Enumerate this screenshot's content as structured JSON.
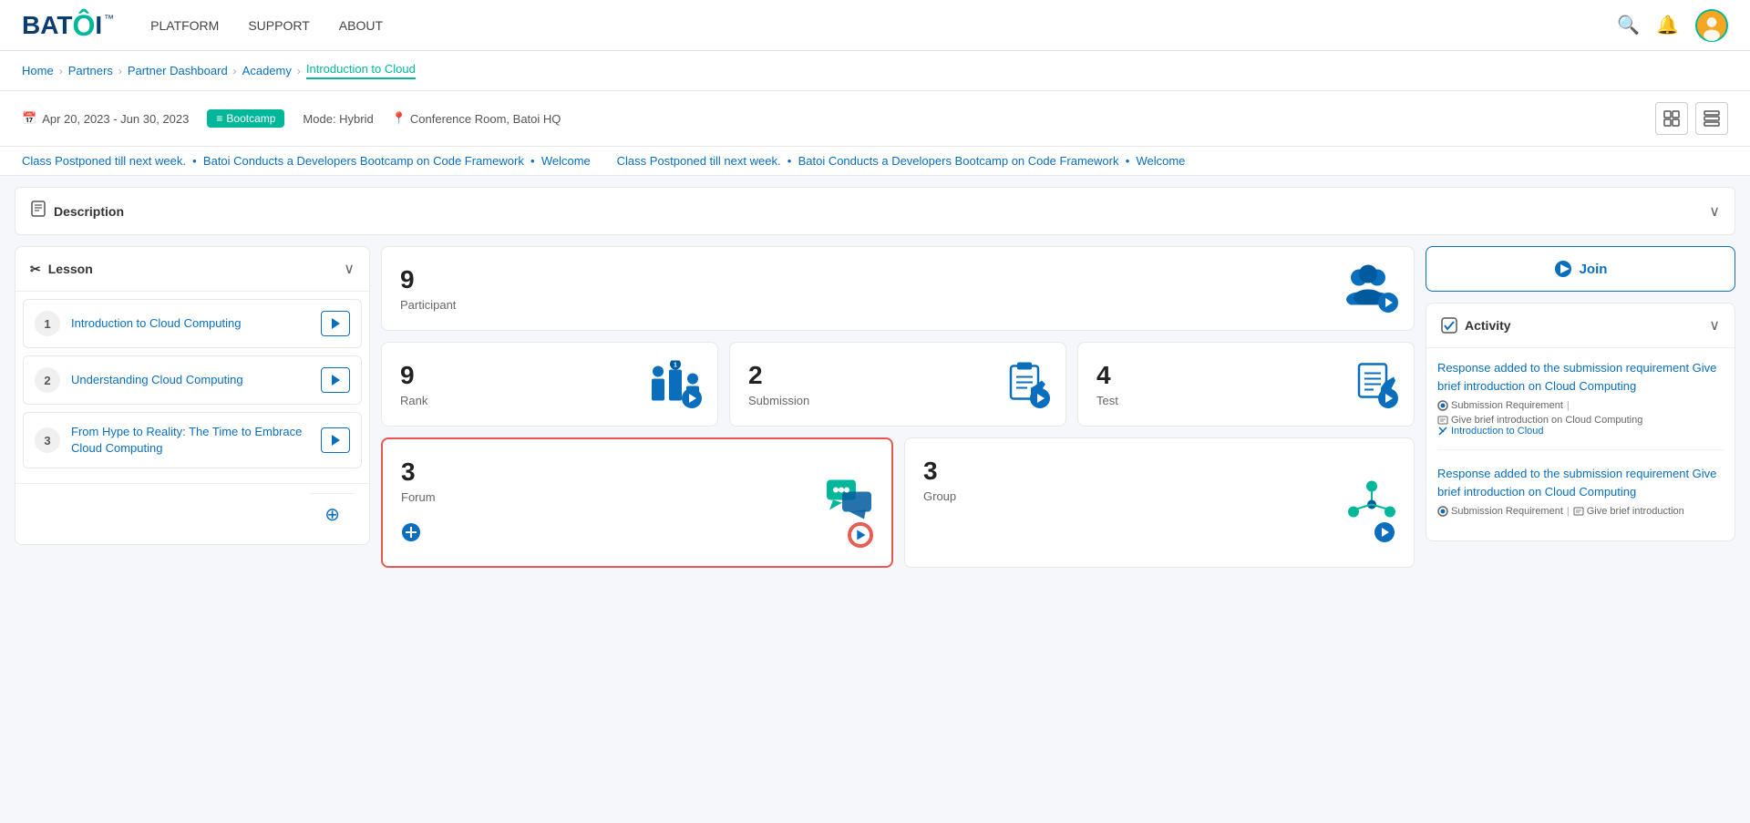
{
  "logo": {
    "text": "BAT",
    "accent": "Ô",
    "suffix": "I"
  },
  "nav": {
    "links": [
      "PLATFORM",
      "SUPPORT",
      "ABOUT"
    ]
  },
  "breadcrumb": {
    "items": [
      "Home",
      "Partners",
      "Partner Dashboard",
      "Academy"
    ],
    "active": "Introduction to Cloud"
  },
  "meta": {
    "date": "Apr 20, 2023  -  Jun 30, 2023",
    "badge": "Bootcamp",
    "mode": "Mode: Hybrid",
    "location": "Conference Room, Batoi HQ"
  },
  "ticker": {
    "messages": [
      "Class Postponed till next week.",
      "Batoi Conducts a Developers Bootcamp on Code Framework",
      "Welcome"
    ]
  },
  "description": {
    "label": "Description"
  },
  "lesson": {
    "header": "Lesson",
    "items": [
      {
        "num": 1,
        "title": "Introduction to Cloud Computing"
      },
      {
        "num": 2,
        "title": "Understanding Cloud Computing"
      },
      {
        "num": 3,
        "title": "From Hype to Reality: The Time to Embrace Cloud Computing"
      }
    ]
  },
  "stats": {
    "participants": {
      "count": 9,
      "label": "Participant"
    },
    "rank": {
      "count": 9,
      "label": "Rank"
    },
    "submission": {
      "count": 2,
      "label": "Submission"
    },
    "test": {
      "count": 4,
      "label": "Test"
    },
    "forum": {
      "count": 3,
      "label": "Forum"
    },
    "group": {
      "count": 3,
      "label": "Group"
    }
  },
  "join": {
    "label": "Join"
  },
  "activity": {
    "header": "Activity",
    "items": [
      {
        "title": "Response added to the submission requirement Give brief introduction on Cloud Computing",
        "meta_type": "Submission Requirement",
        "meta_sep": "|",
        "meta_label": "Give brief introduction on Cloud Computing",
        "link": "Introduction to Cloud"
      },
      {
        "title": "Response added to the submission requirement Give brief introduction on Cloud Computing",
        "meta_type": "Submission Requirement",
        "meta_sep": "|",
        "meta_label": "Give brief introduction"
      }
    ]
  }
}
